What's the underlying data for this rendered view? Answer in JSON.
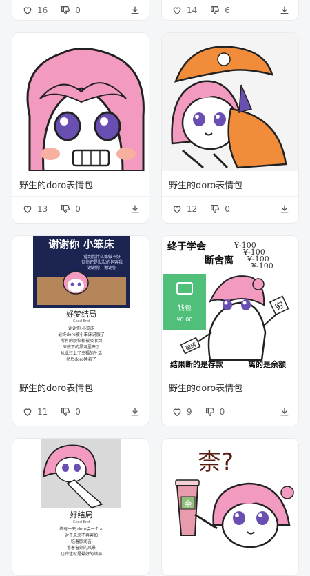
{
  "top_row": [
    {
      "likes": "16",
      "dislikes": "0"
    },
    {
      "likes": "14",
      "dislikes": "6"
    }
  ],
  "cards": [
    {
      "title": "野生的doro表情包",
      "likes": "13",
      "dislikes": "0"
    },
    {
      "title": "野生的doro表情包",
      "likes": "12",
      "dislikes": "0"
    },
    {
      "title": "野生的doro表情包",
      "likes": "11",
      "dislikes": "0"
    },
    {
      "title": "野生的doro表情包",
      "likes": "9",
      "dislikes": "0"
    }
  ],
  "images": {
    "card3": {
      "headline": "谢谢你 小笨床",
      "small_lines": [
        "看到我什么都做不好",
        "但你还是默默的包容我",
        "谢谢你，谢谢你"
      ],
      "subtitle": "好梦结局",
      "subtitle_small": "Good End",
      "body_lines": [
        "谢谢你 小笨床",
        "最终doro被小笨床说服了",
        "所有的烦恼都被吸收到",
        "床底下的黑洞里去了",
        "从此过上了幸福的生活",
        "然后doro睡着了"
      ]
    },
    "card4": {
      "top1": "终于学会",
      "top2": "断舍离",
      "money": [
        "¥-100",
        "¥-100",
        "¥-100",
        "¥-100"
      ],
      "wallet_label": "钱包",
      "wallet_amount": "¥0.00",
      "sign1": "穷",
      "sign2": "破碎",
      "bottom_left": "结果断的是存款",
      "bottom_right": "离的是余额"
    },
    "card5": {
      "subtitle": "好结局",
      "subtitle_small": "Good End",
      "body_lines": [
        "终有一天 doro会一个人",
        "对于未来不再害怕",
        "吃着欧润吉",
        "看着窗外的风景",
        "也许这就是最好的结局"
      ]
    },
    "card6": {
      "glyph": "柰?",
      "cup_label": "柰"
    }
  }
}
